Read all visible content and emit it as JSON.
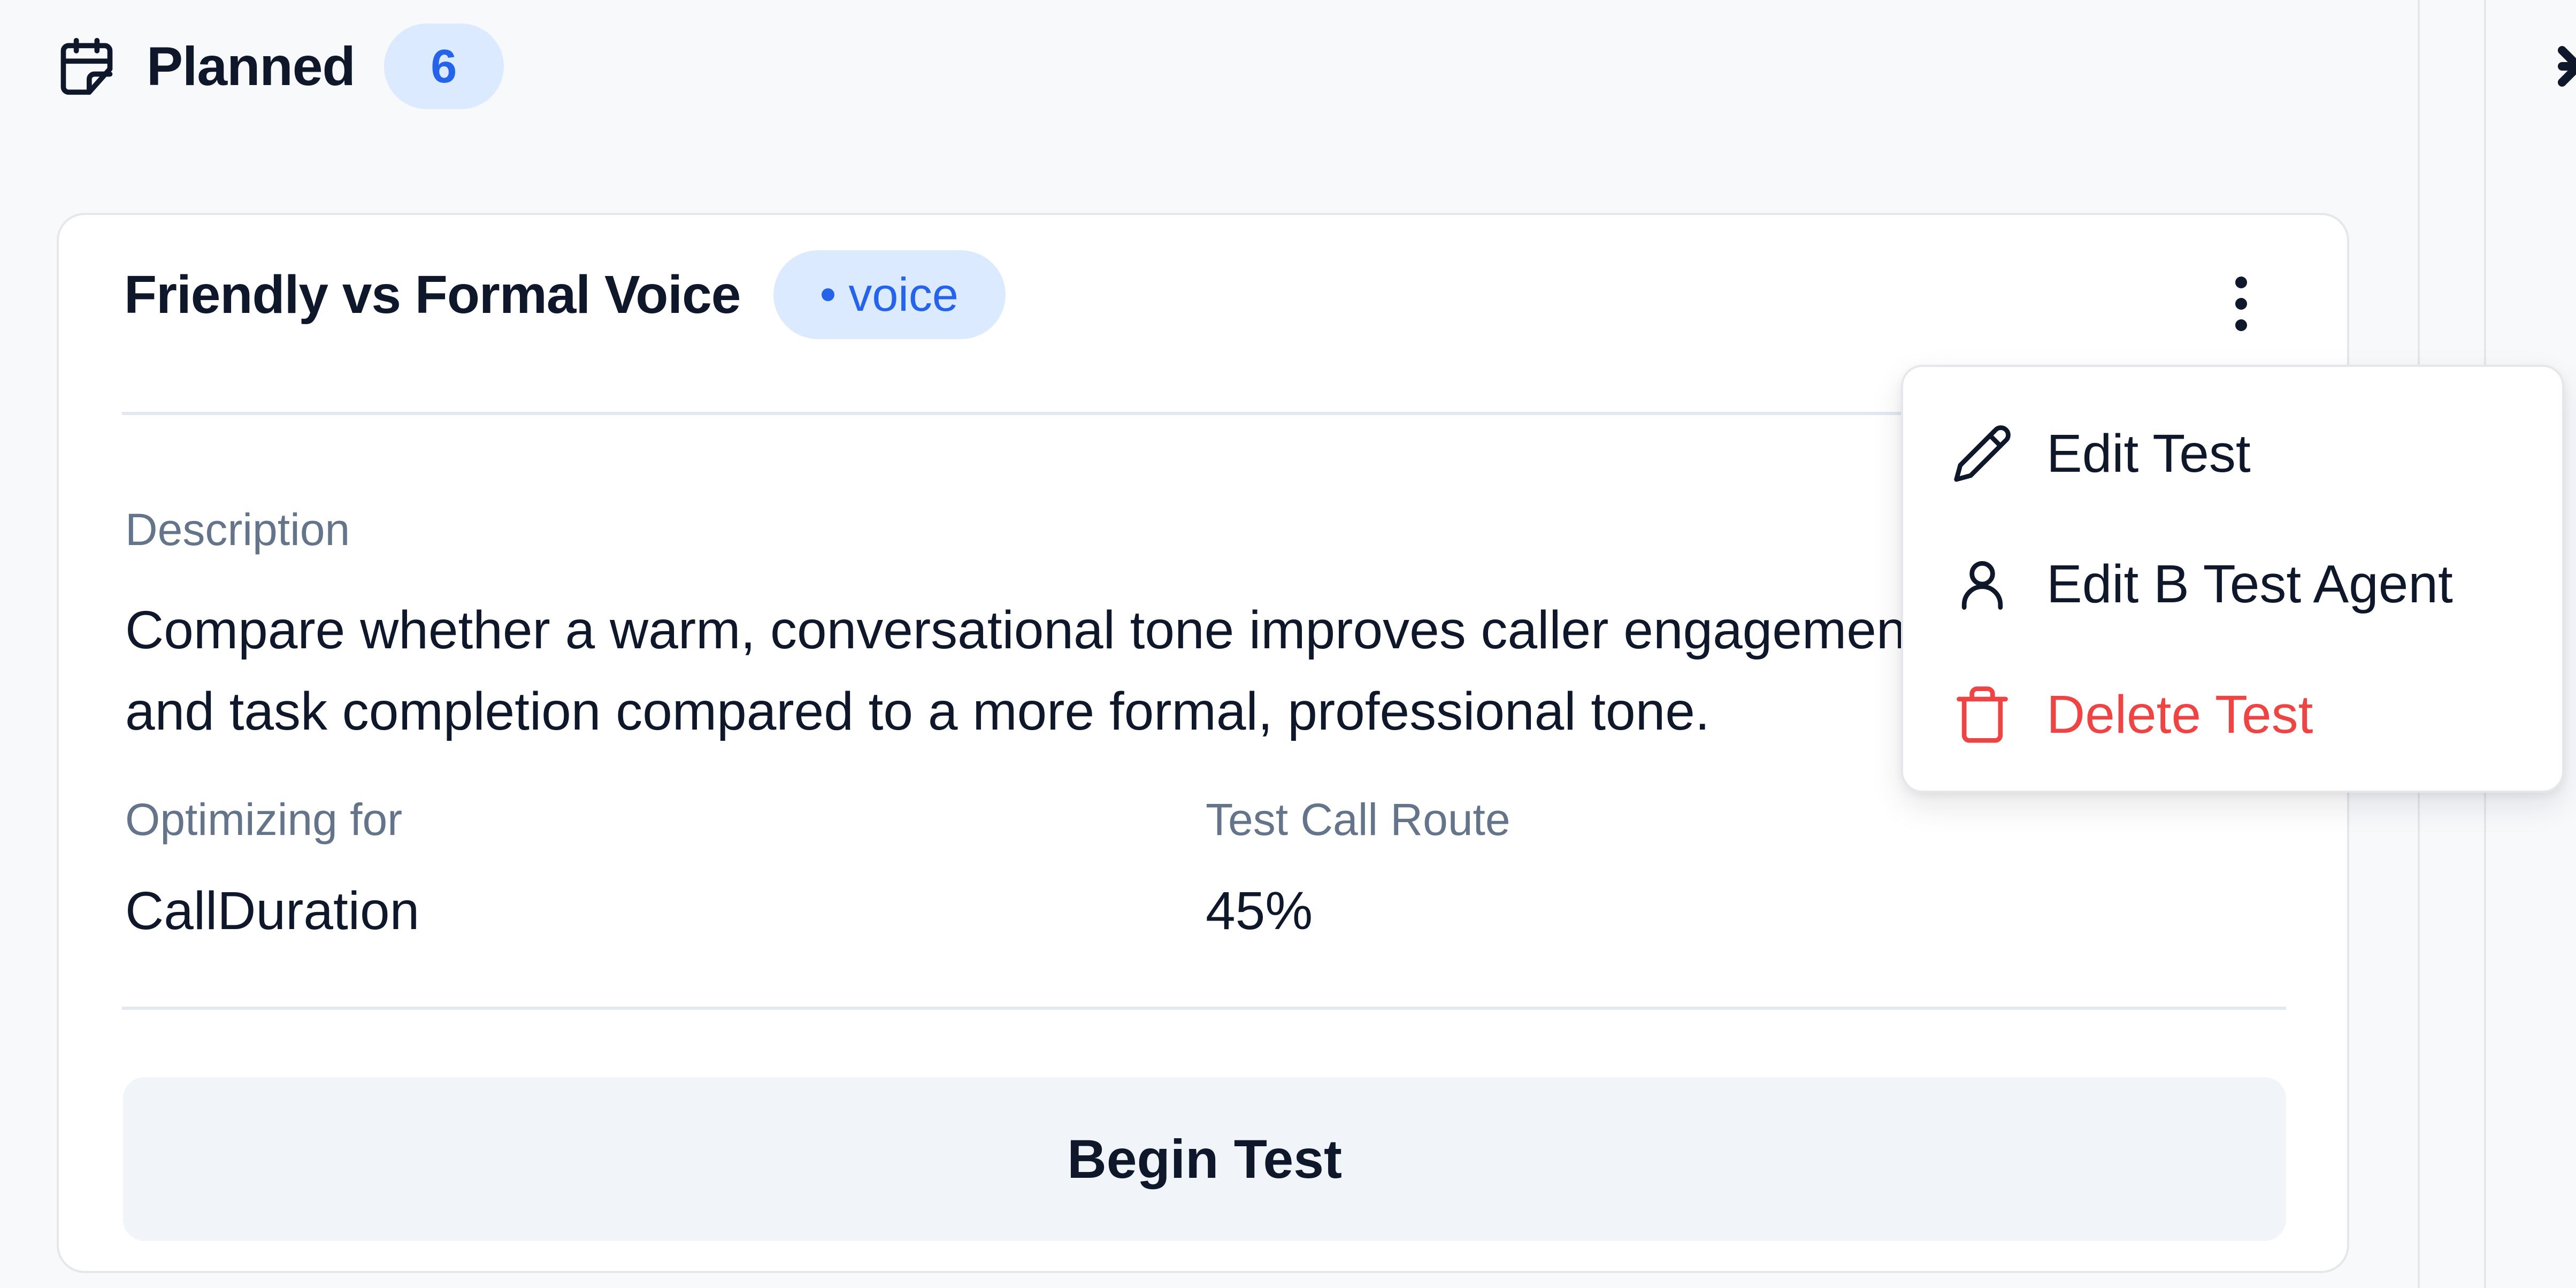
{
  "column": {
    "title": "Planned",
    "count": "6"
  },
  "card": {
    "title": "Friendly vs Formal Voice",
    "tag": "voice",
    "description_label": "Description",
    "description": "Compare whether a warm, conversational tone improves caller engagement and task completion compared to a more formal, professional tone.",
    "optimizing_label": "Optimizing for",
    "optimizing_value": "CallDuration",
    "route_label": "Test Call Route",
    "route_value": "45%",
    "begin_button": "Begin Test"
  },
  "menu": {
    "items": [
      {
        "label": "Edit Test",
        "icon": "pencil-icon"
      },
      {
        "label": "Edit B Test Agent",
        "icon": "user-icon"
      },
      {
        "label": "Delete Test",
        "icon": "trash-icon"
      }
    ]
  },
  "colors": {
    "accent": "#2563eb",
    "accent_bg": "#dbeafe",
    "danger": "#ef4444",
    "muted_text": "#64748b"
  }
}
